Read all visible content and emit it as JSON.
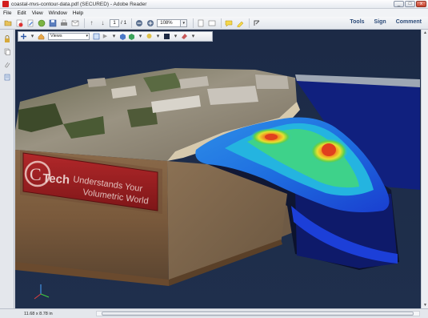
{
  "window": {
    "title": "coastal-mvs-contour-data.pdf (SECURED) - Adobe Reader",
    "controls": [
      "_",
      "□",
      "x"
    ]
  },
  "menu": [
    "File",
    "Edit",
    "View",
    "Window",
    "Help"
  ],
  "toolbar": {
    "page_current": "1",
    "page_total": "/ 1",
    "zoom": "108%",
    "tools": "Tools",
    "sign": "Sign",
    "comment": "Comment"
  },
  "doc_toolbar": {
    "views_label": "Views"
  },
  "scene": {
    "logo_text_c": "C",
    "logo_text_tech": "Tech",
    "banner_line1": "Understands Your",
    "banner_line2": "Volumetric World"
  },
  "status": {
    "page_size": "11.68 x 8.78 in"
  }
}
